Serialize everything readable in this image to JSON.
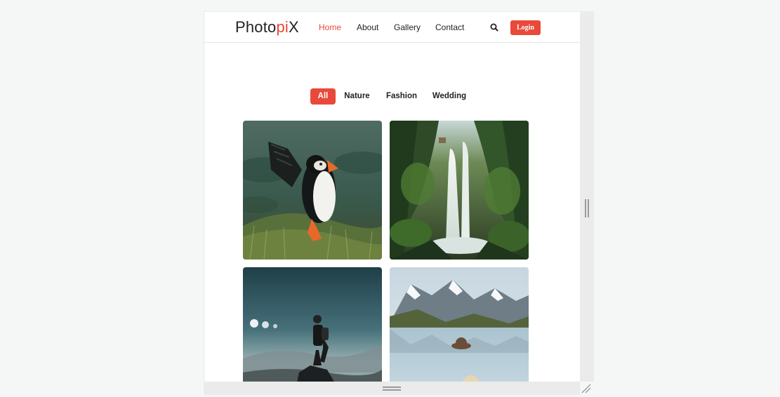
{
  "brand": {
    "prefix": "Photo",
    "accent": "pi",
    "suffix": "X"
  },
  "nav": {
    "home": "Home",
    "about": "About",
    "gallery": "Gallery",
    "contact": "Contact",
    "active": "Home"
  },
  "login": {
    "label": "Login"
  },
  "icons": {
    "search": "search-icon",
    "resize": "resize-handle-icon"
  },
  "filters": {
    "all": "All",
    "nature": "Nature",
    "fashion": "Fashion",
    "wedding": "Wedding",
    "active": "All"
  },
  "gallery": {
    "photos": [
      "puffin",
      "waterfall",
      "hiker-on-rock",
      "mountain-lake"
    ]
  },
  "colors": {
    "accent": "#e8493b",
    "text": "#222222",
    "background": "#f5f7f7"
  }
}
